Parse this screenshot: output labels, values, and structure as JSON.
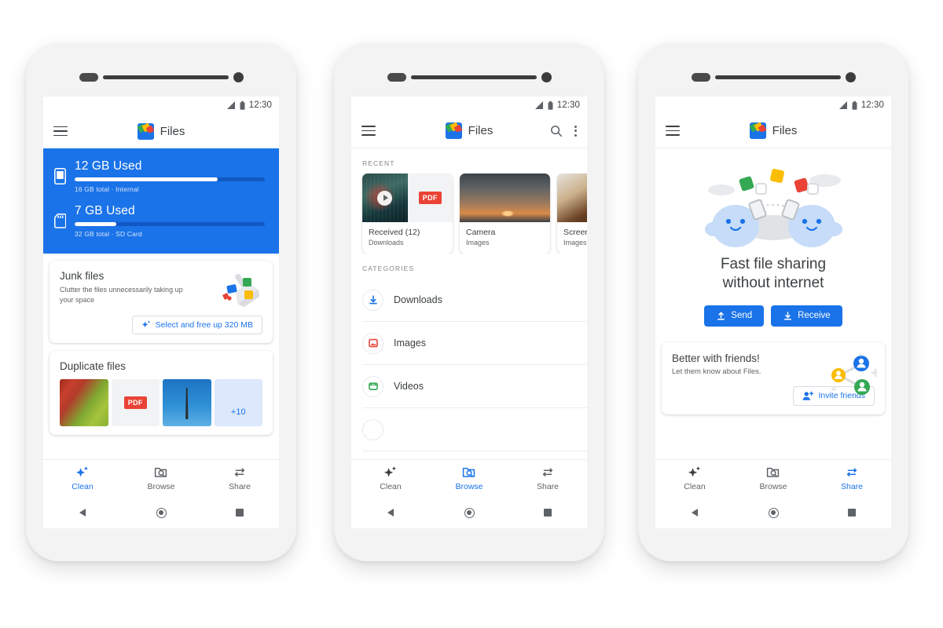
{
  "app": {
    "name": "Files",
    "logo_icon": "files-logo-icon"
  },
  "status_bar": {
    "time": "12:30",
    "signal_icon": "signal-icon",
    "battery_icon": "battery-icon"
  },
  "colors": {
    "brand_blue": "#1a73e8",
    "storage_track": "#1258c4",
    "text_primary": "#3c4043",
    "text_secondary": "#5f6368",
    "green": "#34a853",
    "red": "#ea4335",
    "yellow": "#fbbc04",
    "frame": "#f3f3f3",
    "page_background": "#ffffff"
  },
  "bottom_nav": {
    "items": [
      {
        "label": "Clean",
        "icon": "sparkle-icon"
      },
      {
        "label": "Browse",
        "icon": "folder-search-icon"
      },
      {
        "label": "Share",
        "icon": "share-arrows-icon"
      }
    ]
  },
  "system_nav": {
    "back": "back-triangle-icon",
    "home": "home-circle-icon",
    "recents": "recents-square-icon"
  },
  "phone1": {
    "active_tab": "Clean",
    "menu_icon": "hamburger-menu-icon",
    "storage": [
      {
        "title": "12 GB Used",
        "subtitle": "16 GB total · Internal",
        "percent": 75,
        "icon": "phone-storage-icon"
      },
      {
        "title": "7 GB Used",
        "subtitle": "32 GB total · SD Card",
        "percent": 22,
        "icon": "sd-card-icon"
      }
    ],
    "junk_card": {
      "title": "Junk files",
      "subtitle": "Clutter the files unnecessarily taking up your space",
      "cta_label": "Select and free up 320 MB",
      "cta_icon": "sparkle-icon",
      "art_icon": "broom-sweeping-files-icon"
    },
    "duplicate_card": {
      "title": "Duplicate files",
      "thumbnails": [
        {
          "kind": "photo",
          "name": "apples-photo-thumbnail"
        },
        {
          "kind": "pdf",
          "name": "pdf-file-thumbnail",
          "badge": "PDF"
        },
        {
          "kind": "photo",
          "name": "tower-photo-thumbnail"
        },
        {
          "kind": "more",
          "name": "more-duplicates-thumbnail",
          "label": "+10"
        }
      ]
    }
  },
  "phone2": {
    "active_tab": "Browse",
    "menu_icon": "hamburger-menu-icon",
    "search_icon": "search-icon",
    "overflow_icon": "more-vert-icon",
    "recent_label": "RECENT",
    "recents": [
      {
        "name": "Received (12)",
        "sub": "Downloads",
        "thumb": "video-and-pdf-thumbnail",
        "badge": "PDF"
      },
      {
        "name": "Camera",
        "sub": "Images",
        "thumb": "sunset-clouds-thumbnail"
      },
      {
        "name": "Screen",
        "sub": "Images",
        "thumb": "dessert-photo-thumbnail"
      }
    ],
    "categories_label": "CATEGORIES",
    "categories": [
      {
        "label": "Downloads",
        "icon": "download-icon",
        "color": "#1a73e8"
      },
      {
        "label": "Images",
        "icon": "image-icon",
        "color": "#ea4335"
      },
      {
        "label": "Videos",
        "icon": "video-icon",
        "color": "#34a853"
      }
    ]
  },
  "phone3": {
    "active_tab": "Share",
    "menu_icon": "hamburger-menu-icon",
    "hero": {
      "art_icon": "two-blobs-file-sharing-illustration",
      "title_line1": "Fast file sharing",
      "title_line2": "without internet",
      "buttons": [
        {
          "label": "Send",
          "icon": "upload-icon"
        },
        {
          "label": "Receive",
          "icon": "download-icon"
        }
      ]
    },
    "friends_card": {
      "title": "Better with friends!",
      "subtitle": "Let them know about Files.",
      "cta_label": "Invite friends",
      "cta_icon": "person-add-icon",
      "art_icon": "connected-people-network-icon"
    }
  }
}
